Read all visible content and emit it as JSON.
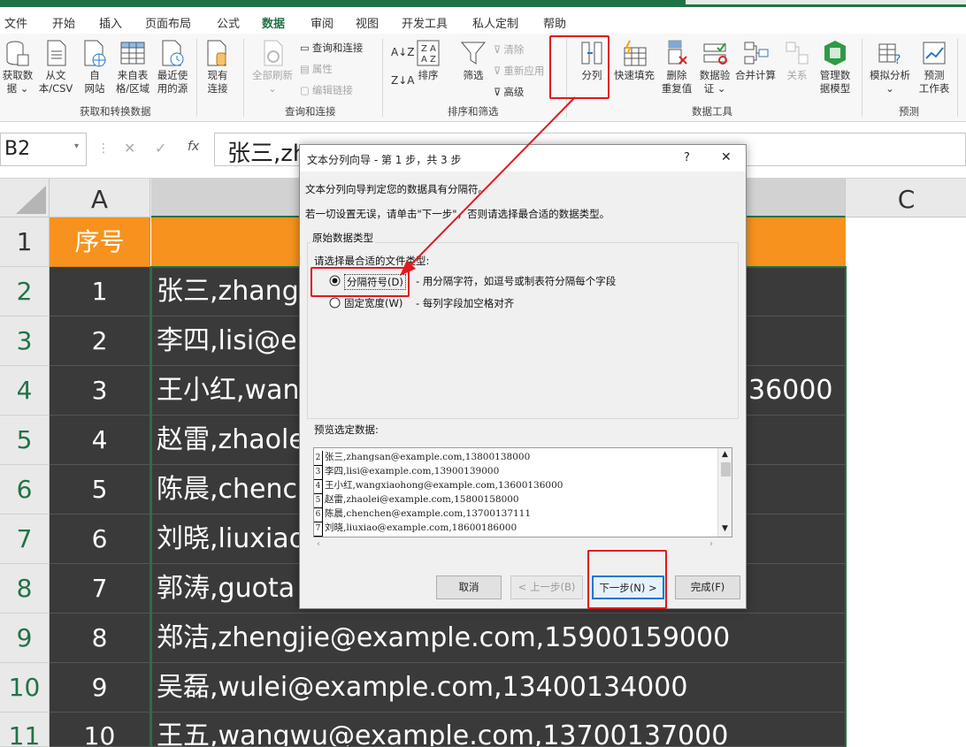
{
  "menu": [
    "文件",
    "开始",
    "插入",
    "页面布局",
    "公式",
    "数据",
    "审阅",
    "视图",
    "开发工具",
    "私人定制",
    "帮助"
  ],
  "ribbon": {
    "get_data": {
      "line1": "获取数",
      "line2": "据 ⌄"
    },
    "from_csv": {
      "line1": "从文",
      "line2": "本/CSV"
    },
    "from_web": {
      "line1": "自",
      "line2": "网站"
    },
    "from_table": {
      "line1": "来自表",
      "line2": "格/区域"
    },
    "recent_sources": {
      "line1": "最近使",
      "line2": "用的源"
    },
    "existing_conn": {
      "line1": "现有",
      "line2": "连接"
    },
    "group_get_transform": "获取和转换数据",
    "refresh_all": {
      "line1": "全部刷新",
      "line2": "⌄"
    },
    "queries_connections": "查询和连接",
    "properties": "属性",
    "edit_links": "编辑链接",
    "group_queries": "查询和连接",
    "sort": "排序",
    "filter": "筛选",
    "clear": "清除",
    "reapply": "重新应用",
    "advanced": "高级",
    "group_sort_filter": "排序和筛选",
    "text_to_columns": "分列",
    "flash_fill": "快速填充",
    "remove_duplicates": {
      "line1": "删除",
      "line2": "重复值"
    },
    "data_validation": {
      "line1": "数据验",
      "line2": "证 ⌄"
    },
    "consolidate": "合并计算",
    "relationships": "关系",
    "manage_model": {
      "line1": "管理数",
      "line2": "据模型"
    },
    "group_data_tools": "数据工具",
    "what_if": {
      "line1": "模拟分析",
      "line2": "⌄"
    },
    "forecast_sheet": {
      "line1": "预测",
      "line2": "工作表"
    },
    "group_forecast": "预测"
  },
  "formula_bar": {
    "name_box": "B2",
    "formula": "张三,zh"
  },
  "columns": [
    "A",
    "C"
  ],
  "header_row": {
    "row": "1",
    "a": "序号"
  },
  "rows": [
    {
      "row": "2",
      "a": "1",
      "b": "张三,zhang"
    },
    {
      "row": "3",
      "a": "2",
      "b": "李四,lisi@e"
    },
    {
      "row": "4",
      "a": "3",
      "b": "王小红,wan",
      "tail": "36000"
    },
    {
      "row": "5",
      "a": "4",
      "b": "赵雷,zhaole"
    },
    {
      "row": "6",
      "a": "5",
      "b": "陈晨,chenc"
    },
    {
      "row": "7",
      "a": "6",
      "b": "刘晓,liuxiao"
    },
    {
      "row": "8",
      "a": "7",
      "b": "郭涛,guota"
    },
    {
      "row": "9",
      "a": "8",
      "b": "郑洁,zhengjie@example.com,15900159000"
    },
    {
      "row": "10",
      "a": "9",
      "b": "吴磊,wulei@example.com,13400134000"
    },
    {
      "row": "11",
      "a": "10",
      "b": "王五,wangwu@example.com,13700137000"
    }
  ],
  "dialog": {
    "title": "文本分列向导 - 第 1 步，共 3 步",
    "help": "?",
    "close": "✕",
    "line1": "文本分列向导判定您的数据具有分隔符。",
    "line2": "若一切设置无误，请单击\"下一步\"，否则请选择最合适的数据类型。",
    "group_title": "原始数据类型",
    "choose_label": "请选择最合适的文件类型:",
    "opt_delimited": "分隔符号(D)",
    "opt_delimited_desc": "- 用分隔字符，如逗号或制表符分隔每个字段",
    "opt_fixed": "固定宽度(W)",
    "opt_fixed_desc": "- 每列字段加空格对齐",
    "preview_label": "预览选定数据:",
    "preview_rows": [
      {
        "n": "2",
        "t": "张三,zhangsan@example.com,13800138000"
      },
      {
        "n": "3",
        "t": "李四,lisi@example.com,13900139000"
      },
      {
        "n": "4",
        "t": "王小红,wangxiaohong@example.com,13600136000"
      },
      {
        "n": "5",
        "t": "赵雷,zhaolei@example.com,15800158000"
      },
      {
        "n": "6",
        "t": "陈晨,chenchen@example.com,13700137111"
      },
      {
        "n": "7",
        "t": "刘晓,liuxiao@example.com,18600186000"
      }
    ],
    "btn_cancel": "取消",
    "btn_prev": "< 上一步(B)",
    "btn_next": "下一步(N) >",
    "btn_finish": "完成(F)"
  }
}
